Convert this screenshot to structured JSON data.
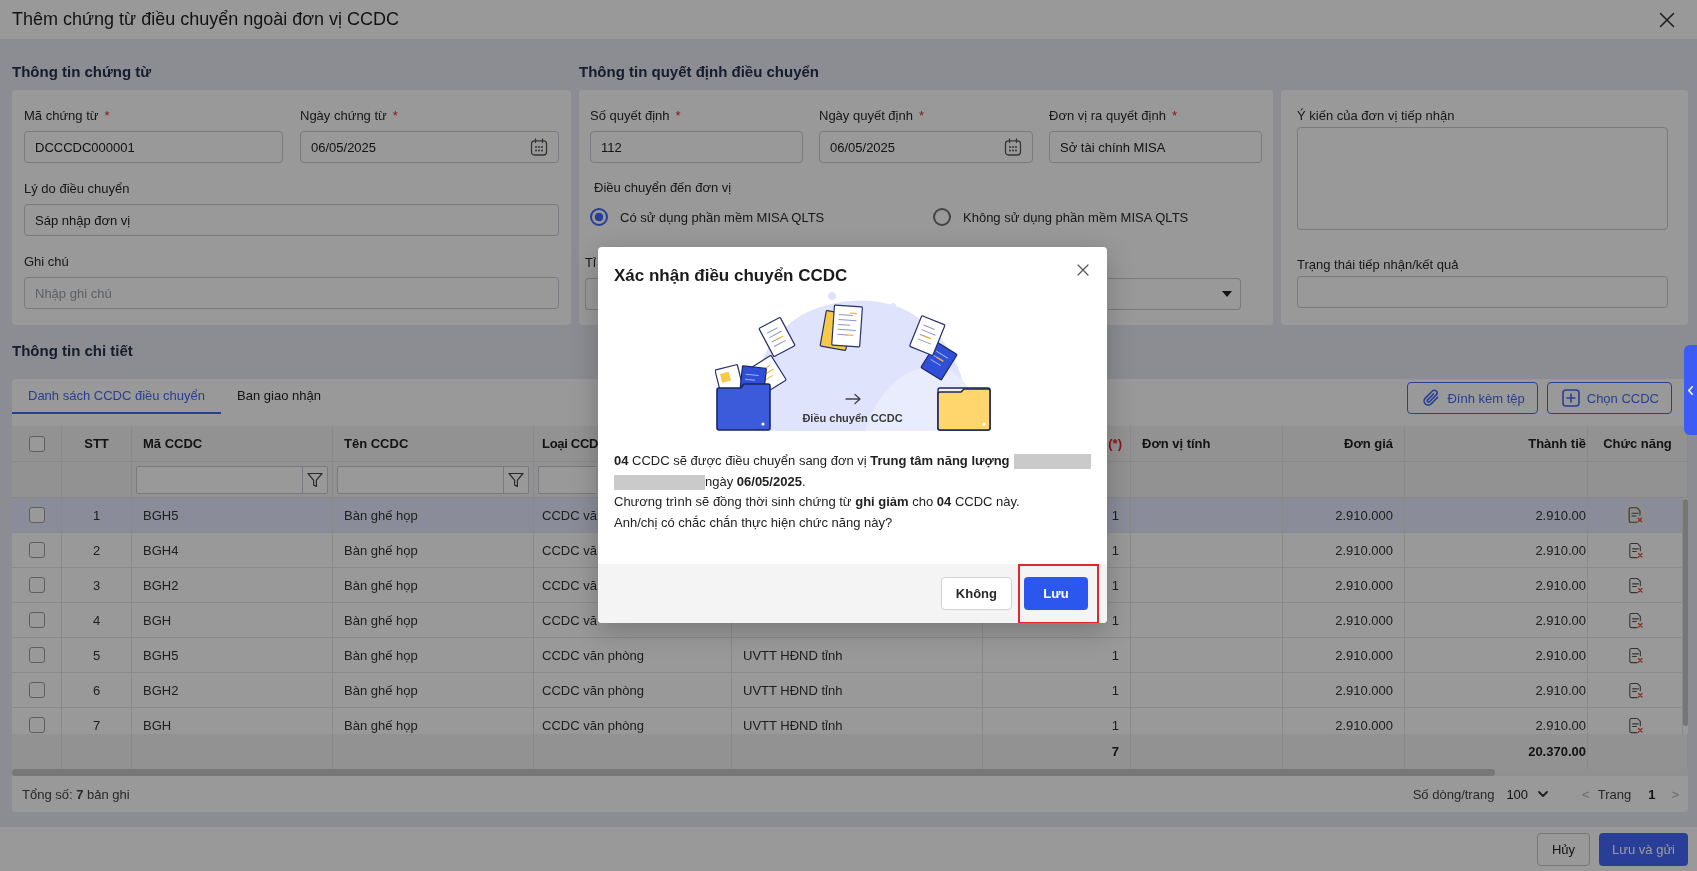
{
  "window": {
    "title": "Thêm chứng từ điều chuyển ngoài đơn vị CCDC"
  },
  "document_info": {
    "heading": "Thông tin chứng từ",
    "fields": [
      {
        "kind": "text",
        "label": "Mã chứng từ",
        "required_mark": "*",
        "value": "DCCCDC000001"
      },
      {
        "kind": "date",
        "label": "Ngày chứng từ",
        "required_mark": "*",
        "value": "06/05/2025"
      },
      {
        "kind": "text",
        "label": "Lý do điều chuyển",
        "value": "Sáp nhập đơn vị"
      },
      {
        "kind": "text",
        "label": "Ghi chú",
        "placeholder": "Nhập ghi chú"
      }
    ]
  },
  "decision_info": {
    "heading": "Thông tin quyết định điều chuyển",
    "fields": [
      {
        "kind": "text",
        "label": "Số quyết định",
        "required_mark": "*",
        "value": "112"
      },
      {
        "kind": "date",
        "label": "Ngày quyết định",
        "required_mark": "*",
        "value": "06/05/2025"
      },
      {
        "kind": "text",
        "label": "Đơn vị ra quyết định",
        "required_mark": "*",
        "value": "Sở tài chính MISA"
      }
    ],
    "transfer_target": {
      "label": "Điều chuyển đến đơn vị",
      "options": [
        {
          "label": "Có sử dụng phần mềm MISA QLTS",
          "selected": true
        },
        {
          "label": "Không sử dụng phần mềm MISA QLTS",
          "selected": false
        }
      ]
    },
    "partly_hidden_fields": [
      {
        "kind": "text",
        "label": "Tỉ"
      },
      {
        "kind": "select"
      }
    ]
  },
  "receiver_info": {
    "fields": [
      {
        "kind": "textarea",
        "label": "Ý kiến của đơn vị tiếp nhận"
      },
      {
        "kind": "text",
        "label": "Trạng thái tiếp nhận/kết quả"
      }
    ]
  },
  "details": {
    "heading": "Thông tin chi tiết",
    "tabs": [
      {
        "label": "Danh sách CCDC điều chuyển",
        "selected": true
      },
      {
        "label": "Ban giao nhận",
        "selected": false
      }
    ],
    "toolbar": [
      {
        "label": "Đính kèm tệp"
      },
      {
        "label": "Chọn CCDC"
      }
    ],
    "table": {
      "select_all": {
        "checked": false
      },
      "columns": [
        {
          "label": "STT"
        },
        {
          "label": "Mã CCDC",
          "filter": true,
          "filter_icon": true
        },
        {
          "label": "Tên CCDC",
          "filter": true,
          "filter_icon": true
        },
        {
          "label": "Loại CCD",
          "filter": true,
          "filter_icon": false
        },
        {},
        {
          "required_mark": "(*)"
        },
        {
          "label": "Đơn vị tính"
        },
        {
          "label": "Đơn giá"
        },
        {
          "label": "Thành tiề"
        },
        {
          "label": "Chức năng"
        }
      ],
      "rows": [
        {
          "checked": false,
          "selected": true,
          "stt": "1",
          "code": "BGH5",
          "name": "Bàn ghế họp",
          "type": "CCDC vă",
          "column_7": "1",
          "unit_price": "2.910.000",
          "amount": "2.910.00"
        },
        {
          "checked": false,
          "selected": false,
          "stt": "2",
          "code": "BGH4",
          "name": "Bàn ghế họp",
          "type": "CCDC vă",
          "column_7": "1",
          "unit_price": "2.910.000",
          "amount": "2.910.00"
        },
        {
          "checked": false,
          "selected": false,
          "stt": "3",
          "code": "BGH2",
          "name": "Bàn ghế họp",
          "type": "CCDC vă",
          "column_7": "1",
          "unit_price": "2.910.000",
          "amount": "2.910.00"
        },
        {
          "checked": false,
          "selected": false,
          "stt": "4",
          "code": "BGH",
          "name": "Bàn ghế họp",
          "type": "CCDC vă",
          "column_7": "1",
          "unit_price": "2.910.000",
          "amount": "2.910.00"
        },
        {
          "checked": false,
          "selected": false,
          "stt": "5",
          "code": "BGH5",
          "name": "Bàn ghế họp",
          "type": "CCDC văn phòng",
          "column_6": "UVTT HĐND tỉnh",
          "column_7": "1",
          "unit_price": "2.910.000",
          "amount": "2.910.00"
        },
        {
          "checked": false,
          "selected": false,
          "stt": "6",
          "code": "BGH2",
          "name": "Bàn ghế họp",
          "type": "CCDC văn phòng",
          "column_6": "UVTT HĐND tỉnh",
          "column_7": "1",
          "unit_price": "2.910.000",
          "amount": "2.910.00"
        },
        {
          "checked": false,
          "selected": false,
          "stt": "7",
          "code": "BGH",
          "name": "Bàn ghế họp",
          "type": "CCDC văn phòng",
          "column_6": "UVTT HĐND tỉnh",
          "column_7": "1",
          "unit_price": "2.910.000",
          "amount": "2.910.00"
        }
      ],
      "totals": {
        "column_7": "7",
        "amount": "20.370.00"
      }
    },
    "footer": {
      "total_records": "Tổng số: **7** bản ghi",
      "rows_per_page_label": "Số dòng/trang",
      "rows_per_page": "100",
      "prev": {
        "symbol": "<",
        "disabled": true
      },
      "page_label": "Trang",
      "page": "1",
      "next": {
        "symbol": ">",
        "disabled": true
      }
    }
  },
  "bottom_actions": [
    {
      "label": "Hủy",
      "kind": "secondary"
    },
    {
      "label": "Lưu và gửi",
      "kind": "primary"
    }
  ],
  "dialog": {
    "title": "Xác nhận điều chuyển CCDC",
    "illustration_caption": "Điều chuyển CCDC",
    "message_lines": [
      {
        "parts": [
          {
            "kind": "text",
            "text": "**04** CCDC sẽ được điều chuyển sang đơn vị **Trung tâm năng lượng**"
          },
          {
            "kind": "redacted"
          }
        ]
      },
      {
        "parts": [
          {
            "kind": "redacted"
          },
          {
            "kind": "text",
            "text": "ngày **06/05/2025**."
          }
        ]
      },
      {
        "parts": [
          {
            "kind": "text",
            "text": "Chương trình sẽ đồng thời sinh chứng từ **ghi giảm** cho **04** CCDC này."
          }
        ]
      },
      {
        "parts": [
          {
            "kind": "text",
            "text": "Anh/chị có chắc chắn thực hiện chức năng này?"
          }
        ]
      }
    ],
    "buttons": [
      {
        "label": "Không",
        "kind": "secondary",
        "highlighted": false
      },
      {
        "label": "Lưu",
        "kind": "primary",
        "highlighted": true
      }
    ]
  }
}
